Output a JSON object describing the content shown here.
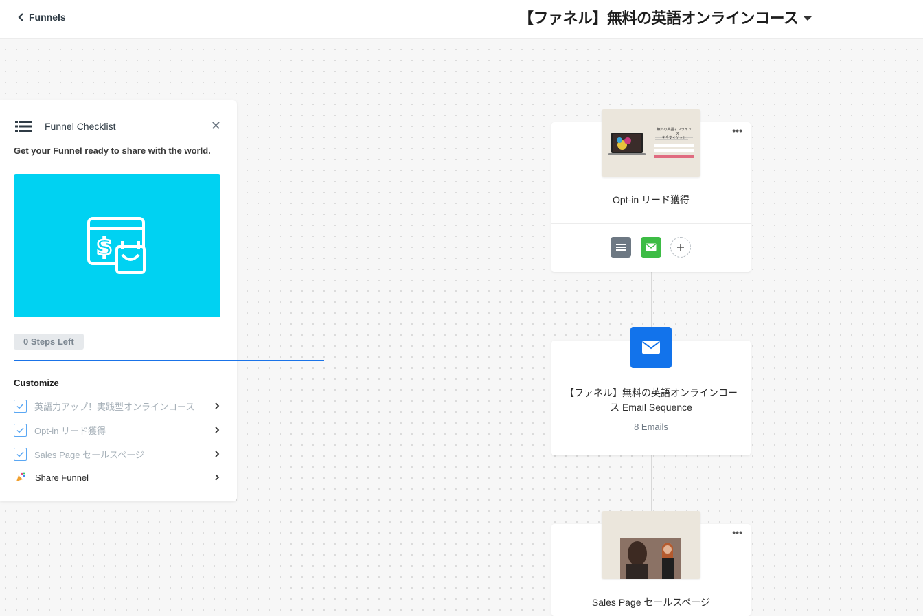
{
  "header": {
    "back_label": "Funnels",
    "funnel_name": "【ファネル】無料の英語オンラインコース"
  },
  "checklist": {
    "title": "Funnel Checklist",
    "subtitle": "Get your Funnel ready to share with the world.",
    "steps_left": "0 Steps Left",
    "section_label": "Customize",
    "items": [
      {
        "label": "英語力アップ！実践型オンラインコース",
        "done": true
      },
      {
        "label": "Opt-in リード獲得",
        "done": true
      },
      {
        "label": "Sales Page セールスページ",
        "done": true
      },
      {
        "label": "Share Funnel",
        "done": false
      }
    ],
    "colors": {
      "hero": "#00d2f2",
      "progress": "#1a73e8"
    }
  },
  "flow": {
    "optin_card": {
      "title": "Opt-in リード獲得",
      "menu": "•••",
      "thumb_heading": "無料の英語オンラインコース",
      "thumb_sub": "を今すぐゲット！"
    },
    "email_card": {
      "title": "【ファネル】無料の英語オンラインコース Email Sequence",
      "count": "8 Emails"
    },
    "sales_card": {
      "title": "Sales Page セールスページ",
      "menu": "•••"
    },
    "icons": {
      "form": "list-form-icon",
      "email": "envelope-icon",
      "add": "plus-icon"
    },
    "colors": {
      "form": "#6d7883",
      "email_green": "#3dbc45",
      "email_blue": "#1273eb"
    }
  }
}
